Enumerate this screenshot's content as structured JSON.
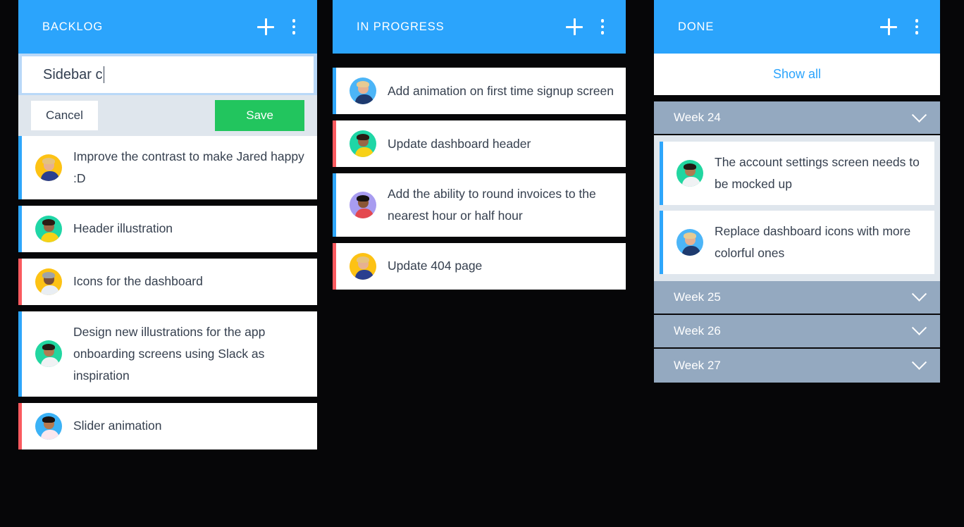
{
  "theme": {
    "header_blue": "#2ba4fc",
    "accent_blue": "#2ea6fb",
    "accent_red": "#fa5a5f",
    "save_green": "#22c55e",
    "week_slate": "#94a9c0",
    "group_bg": "#dfe6ed",
    "text_dark": "#36404f",
    "page_bg": "#060608"
  },
  "columns": [
    {
      "id": "backlog",
      "title": "BACKLOG",
      "add_icon": "plus-icon",
      "menu_icon": "more-vertical-icon",
      "compose": {
        "value": "Sidebar c",
        "placeholder": "",
        "cancel_label": "Cancel",
        "save_label": "Save"
      },
      "cards": [
        {
          "title": "Improve the contrast to make Jared happy :D",
          "accent": "blue",
          "avatar": "avatar-blonde-yellow"
        },
        {
          "title": "Header illustration",
          "accent": "blue",
          "avatar": "avatar-curly-teal"
        },
        {
          "title": "Icons for the dashboard",
          "accent": "red",
          "avatar": "avatar-man-yellow"
        },
        {
          "title": "Design new illustrations for the app onboarding screens using Slack as inspiration",
          "accent": "blue",
          "avatar": "avatar-man-green"
        },
        {
          "title": "Slider animation",
          "accent": "red",
          "avatar": "avatar-man-blue"
        }
      ]
    },
    {
      "id": "in-progress",
      "title": "IN PROGRESS",
      "add_icon": "plus-icon",
      "menu_icon": "more-vertical-icon",
      "cards": [
        {
          "title": "Add animation on first time signup screen",
          "accent": "blue",
          "avatar": "avatar-blonde-blue"
        },
        {
          "title": "Update dashboard header",
          "accent": "red",
          "avatar": "avatar-curly-teal"
        },
        {
          "title": "Add the ability to round invoices to the nearest hour or half hour",
          "accent": "blue",
          "avatar": "avatar-woman-purple"
        },
        {
          "title": "Update 404 page",
          "accent": "red",
          "avatar": "avatar-blonde-yellow"
        }
      ]
    },
    {
      "id": "done",
      "title": "DONE",
      "add_icon": "plus-icon",
      "menu_icon": "more-vertical-icon",
      "show_all_label": "Show all",
      "weeks": [
        {
          "label": "Week 24",
          "expanded": true,
          "chevron_icon": "chevron-down-icon",
          "cards": [
            {
              "title": "The account settings screen needs to be mocked up",
              "accent": "blue",
              "avatar": "avatar-man-green"
            },
            {
              "title": "Replace dashboard icons with more colorful ones",
              "accent": "blue",
              "avatar": "avatar-blonde-blue"
            }
          ]
        },
        {
          "label": "Week 25",
          "expanded": false,
          "chevron_icon": "chevron-down-icon",
          "cards": []
        },
        {
          "label": "Week 26",
          "expanded": false,
          "chevron_icon": "chevron-down-icon",
          "cards": []
        },
        {
          "label": "Week 27",
          "expanded": false,
          "chevron_icon": "chevron-down-icon",
          "cards": []
        }
      ]
    }
  ]
}
